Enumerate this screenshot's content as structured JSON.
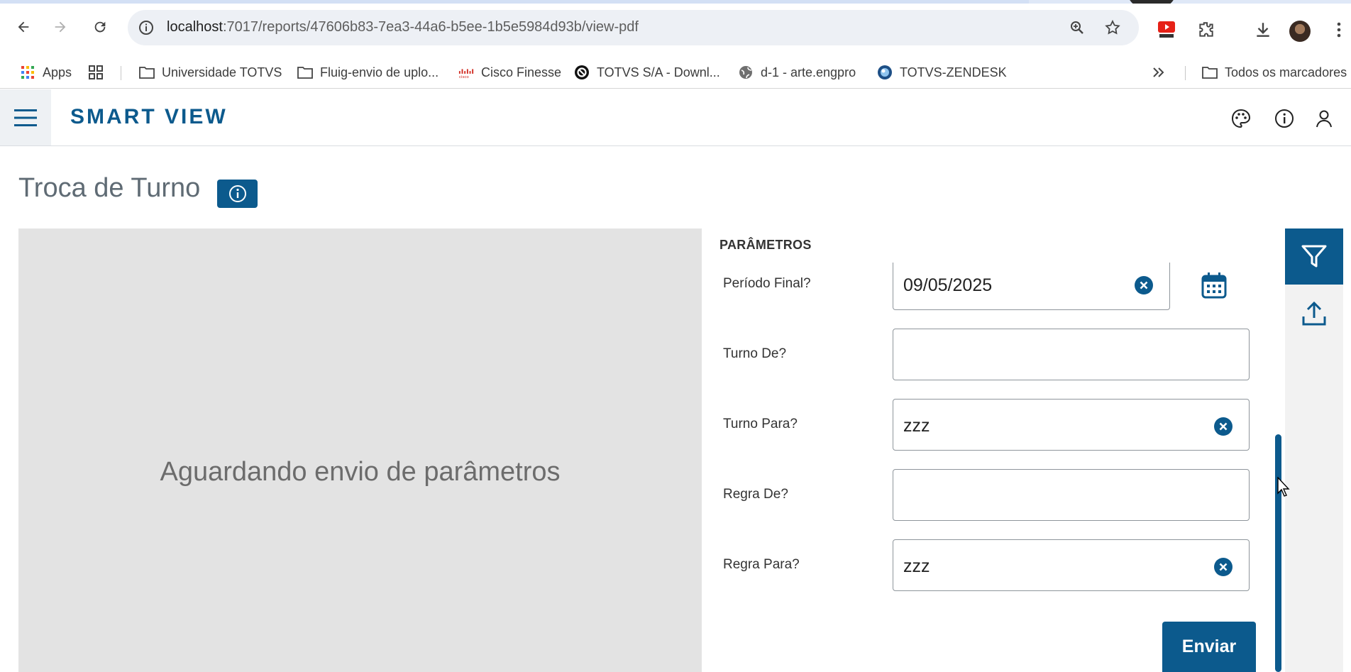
{
  "browser": {
    "url_host": "localhost",
    "url_path": ":7017/reports/47606b83-7ea3-44a6-b5ee-1b5e5984d93b/view-pdf",
    "bookmarks": [
      {
        "label": "Apps",
        "icon": "apps-grid-icon"
      },
      {
        "label": "",
        "icon": "tab-groups-icon"
      },
      {
        "label": "Universidade TOTVS",
        "icon": "folder-icon"
      },
      {
        "label": "Fluig-envio de uplo...",
        "icon": "folder-icon"
      },
      {
        "label": "Cisco Finesse",
        "icon": "cisco-icon"
      },
      {
        "label": "TOTVS S/A - Downl...",
        "icon": "totvs-icon"
      },
      {
        "label": "d-1 - arte.engpro",
        "icon": "globe-icon"
      },
      {
        "label": "TOTVS-ZENDESK",
        "icon": "zendesk-icon"
      }
    ],
    "other_bookmarks": "Todos os marcadores"
  },
  "app": {
    "brand": "SMART VIEW"
  },
  "page": {
    "title": "Troca de Turno",
    "preview_message": "Aguardando envio de parâmetros"
  },
  "params": {
    "title": "PARÂMETROS",
    "fields": [
      {
        "label": "Período Final?",
        "value": "09/05/2025"
      },
      {
        "label": "Turno De?",
        "value": ""
      },
      {
        "label": "Turno Para?",
        "value": "zzz"
      },
      {
        "label": "Regra De?",
        "value": ""
      },
      {
        "label": "Regra Para?",
        "value": "zzz"
      }
    ],
    "submit_label": "Enviar"
  },
  "colors": {
    "primary": "#0c5a8d",
    "preview_bg": "#e3e3e3"
  }
}
